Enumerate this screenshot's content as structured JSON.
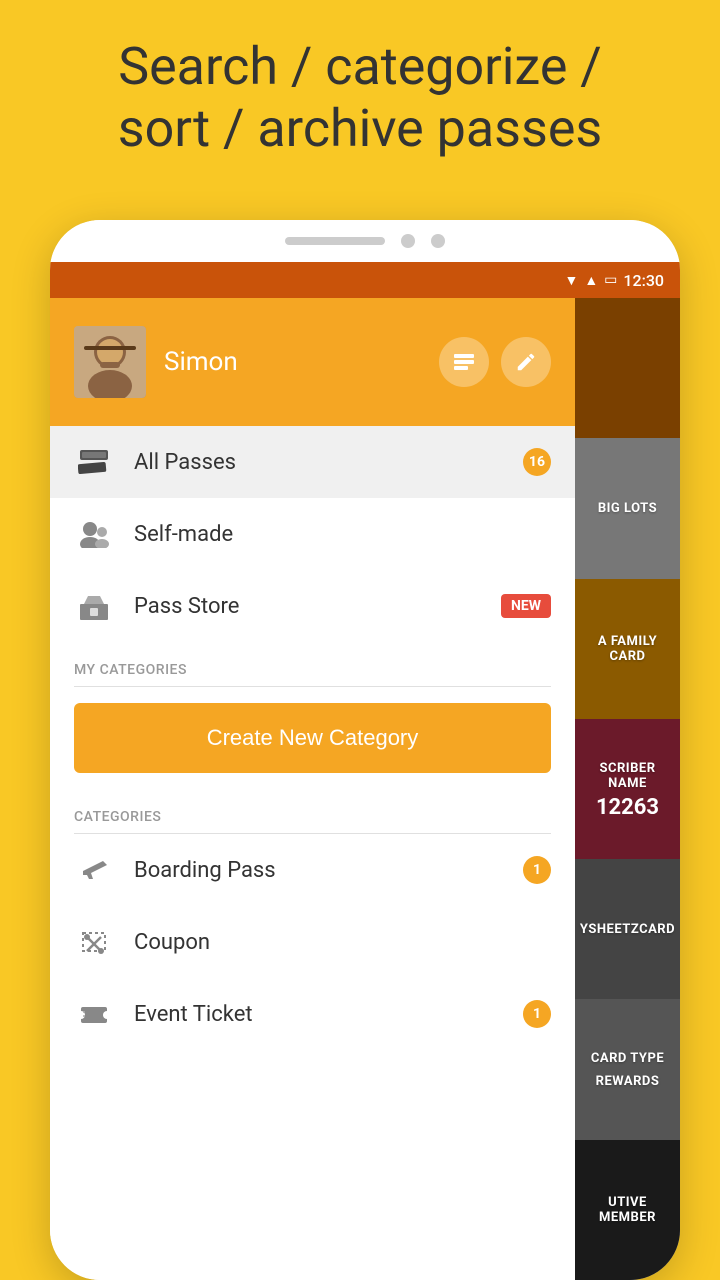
{
  "promo": {
    "line1": "Search / categorize /",
    "line2": "sort / archive passes"
  },
  "statusBar": {
    "time": "12:30",
    "wifiIcon": "▼",
    "signalIcon": "▲",
    "batteryIcon": "▭"
  },
  "drawer": {
    "user": {
      "name": "Simon"
    },
    "actions": {
      "passes_icon": "⊟",
      "edit_icon": "✎"
    },
    "menuItems": [
      {
        "id": "all-passes",
        "label": "All Passes",
        "badge": "16",
        "active": true
      },
      {
        "id": "self-made",
        "label": "Self-made",
        "badge": null,
        "active": false
      },
      {
        "id": "pass-store",
        "label": "Pass Store",
        "badge": "NEW",
        "active": false
      }
    ],
    "myCategories": {
      "heading": "MY CATEGORIES",
      "createBtn": "Create New Category"
    },
    "categories": {
      "heading": "CATEGORIES",
      "items": [
        {
          "id": "boarding-pass",
          "label": "Boarding Pass",
          "badge": "1"
        },
        {
          "id": "coupon",
          "label": "Coupon",
          "badge": null
        },
        {
          "id": "event-ticket",
          "label": "Event Ticket",
          "badge": "1"
        }
      ]
    }
  },
  "cards": [
    {
      "id": "card-1",
      "label": "",
      "colorClass": "card-1"
    },
    {
      "id": "card-2",
      "label": "BIG LOTS",
      "colorClass": "card-2"
    },
    {
      "id": "card-3",
      "label": "A FAMILY CARD",
      "colorClass": "card-3"
    },
    {
      "id": "card-4",
      "label": "SCRIBER NAME\n12263",
      "colorClass": "card-4",
      "number": "12263",
      "sublabel": "SCRIBER NAME"
    },
    {
      "id": "card-5",
      "label": "YSHEETZCARD",
      "colorClass": "card-5"
    },
    {
      "id": "card-6",
      "label": "CARD TYPE\nREWARDS",
      "colorClass": "card-6"
    },
    {
      "id": "card-7",
      "label": "UTIVE MEMBER",
      "colorClass": "card-7"
    }
  ],
  "icons": {
    "passes": "🎫",
    "selfMade": "👤",
    "store": "🏪",
    "boarding": "✈",
    "coupon": "✂",
    "ticket": "🎟"
  }
}
